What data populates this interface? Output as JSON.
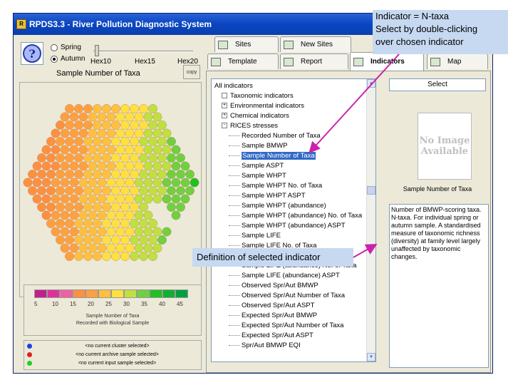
{
  "window": {
    "title": "RPDS3.3 - River Pollution Diagnostic System",
    "icon": "app-icon"
  },
  "season": {
    "options": [
      "Spring",
      "Autumn"
    ],
    "selected": "Autumn"
  },
  "slider": {
    "labels": [
      "Hex10",
      "Hex15",
      "Hex20"
    ]
  },
  "map": {
    "title": "Sample Number of Taxa",
    "copy_label": "copy"
  },
  "legend": {
    "colors": [
      "#c0208c",
      "#e0309c",
      "#f060a0",
      "#ff9040",
      "#ffa040",
      "#ffc040",
      "#ffe040",
      "#c0e040",
      "#70d040",
      "#20c020",
      "#10b030",
      "#00a040"
    ],
    "ticks": [
      "5",
      "10",
      "15",
      "20",
      "25",
      "30",
      "35",
      "40",
      "45"
    ],
    "caption_line1": "Sample Number of Taxa",
    "caption_line2": "Recorded with Biological Sample"
  },
  "status": [
    {
      "color": "#2040e0",
      "text": "<no current cluster selected>"
    },
    {
      "color": "#e02020",
      "text": "<no current archive sample selected>"
    },
    {
      "color": "#20d020",
      "text": "<no current input sample selected>"
    }
  ],
  "tabs": [
    {
      "label": "Sites",
      "active": false
    },
    {
      "label": "New Sites",
      "active": false
    },
    {
      "label": "Template",
      "active": false
    },
    {
      "label": "Report",
      "active": false
    },
    {
      "label": "Indicators",
      "active": true
    },
    {
      "label": "Map",
      "active": false
    }
  ],
  "tree": {
    "items": [
      {
        "label": "All indicators",
        "level": 0,
        "expander": "",
        "selected": false
      },
      {
        "label": "Taxonomic indicators",
        "level": 1,
        "expander": "",
        "selected": false
      },
      {
        "label": "Environmental indicators",
        "level": 1,
        "expander": "+",
        "selected": false
      },
      {
        "label": "Chemical indicators",
        "level": 1,
        "expander": "+",
        "selected": false
      },
      {
        "label": "RICES stresses",
        "level": 1,
        "expander": "-",
        "selected": false
      },
      {
        "label": "Recorded Number of Taxa",
        "level": 2,
        "expander": "",
        "selected": false
      },
      {
        "label": "Sample BMWP",
        "level": 2,
        "expander": "",
        "selected": false
      },
      {
        "label": "Sample Number of Taxa",
        "level": 2,
        "expander": "",
        "selected": true
      },
      {
        "label": "Sample ASPT",
        "level": 2,
        "expander": "",
        "selected": false
      },
      {
        "label": "Sample WHPT",
        "level": 2,
        "expander": "",
        "selected": false
      },
      {
        "label": "Sample WHPT No. of Taxa",
        "level": 2,
        "expander": "",
        "selected": false
      },
      {
        "label": "Sample WHPT ASPT",
        "level": 2,
        "expander": "",
        "selected": false
      },
      {
        "label": "Sample WHPT (abundance)",
        "level": 2,
        "expander": "",
        "selected": false
      },
      {
        "label": "Sample WHPT (abundance) No. of Taxa",
        "level": 2,
        "expander": "",
        "selected": false
      },
      {
        "label": "Sample WHPT (abundance) ASPT",
        "level": 2,
        "expander": "",
        "selected": false
      },
      {
        "label": "Sample LIFE",
        "level": 2,
        "expander": "",
        "selected": false
      },
      {
        "label": "Sample LIFE No. of Taxa",
        "level": 2,
        "expander": "",
        "selected": false
      },
      {
        "label": "Sample LIFE (abundance)",
        "level": 2,
        "expander": "",
        "selected": false
      },
      {
        "label": "Sample LIFE (abundance) No. of Taxa",
        "level": 2,
        "expander": "",
        "selected": false
      },
      {
        "label": "Sample LIFE (abundance) ASPT",
        "level": 2,
        "expander": "",
        "selected": false
      },
      {
        "label": "Observed Spr/Aut BMWP",
        "level": 2,
        "expander": "",
        "selected": false
      },
      {
        "label": "Observed Spr/Aut Number of Taxa",
        "level": 2,
        "expander": "",
        "selected": false
      },
      {
        "label": "Observed Spr/Aut ASPT",
        "level": 2,
        "expander": "",
        "selected": false
      },
      {
        "label": "Expected Spr/Aut BMWP",
        "level": 2,
        "expander": "",
        "selected": false
      },
      {
        "label": "Expected Spr/Aut Number of Taxa",
        "level": 2,
        "expander": "",
        "selected": false
      },
      {
        "label": "Expected Spr/Aut ASPT",
        "level": 2,
        "expander": "",
        "selected": false
      },
      {
        "label": "Spr/Aut BMWP EQI",
        "level": 2,
        "expander": "",
        "selected": false
      }
    ]
  },
  "right_panel": {
    "select_label": "Select",
    "no_image_line1": "No Image",
    "no_image_line2": "Available",
    "image_caption": "Sample Number of Taxa",
    "definition": "Number of BMWP-scoring taxa. N-taxa. For individual spring or autumn sample. A standardised measure of taxonomic richness (diversity) at family level largely unaffected by taxonomic changes."
  },
  "callouts": {
    "top_line1": "Indicator = N-taxa",
    "top_line2": "Select by double-clicking",
    "top_line3": "over chosen indicator",
    "bottom": "Definition of selected indicator",
    "arrow_color": "#cc22aa"
  }
}
